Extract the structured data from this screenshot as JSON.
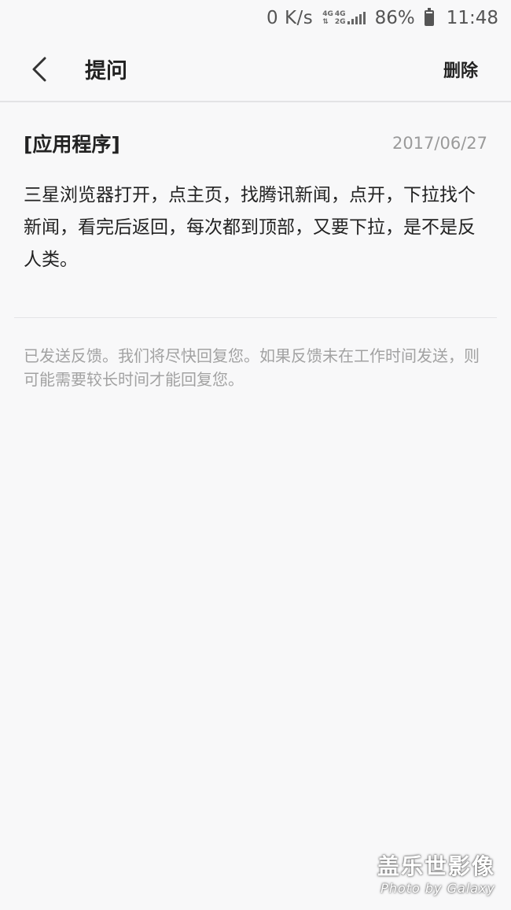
{
  "status_bar": {
    "net_speed": "0 K/s",
    "net_type_top": "4G",
    "net_type_bottom_a": "4G",
    "net_type_bottom_b": "2G",
    "battery": "86%",
    "battery_level": 0.86,
    "time": "11:48"
  },
  "app_bar": {
    "back_icon": "chevron-left-icon",
    "title": "提问",
    "delete_label": "删除"
  },
  "question": {
    "category": "[应用程序]",
    "date": "2017/06/27",
    "body": "三星浏览器打开，点主页，找腾讯新闻，点开，下拉找个新闻，看完后返回，每次都到顶部，又要下拉，是不是反人类。"
  },
  "feedback_note": "已发送反馈。我们将尽快回复您。如果反馈未在工作时间发送，则可能需要较长时间才能回复您。",
  "watermark": {
    "cn": "盖乐世影像",
    "en": "Photo by Galaxy"
  }
}
